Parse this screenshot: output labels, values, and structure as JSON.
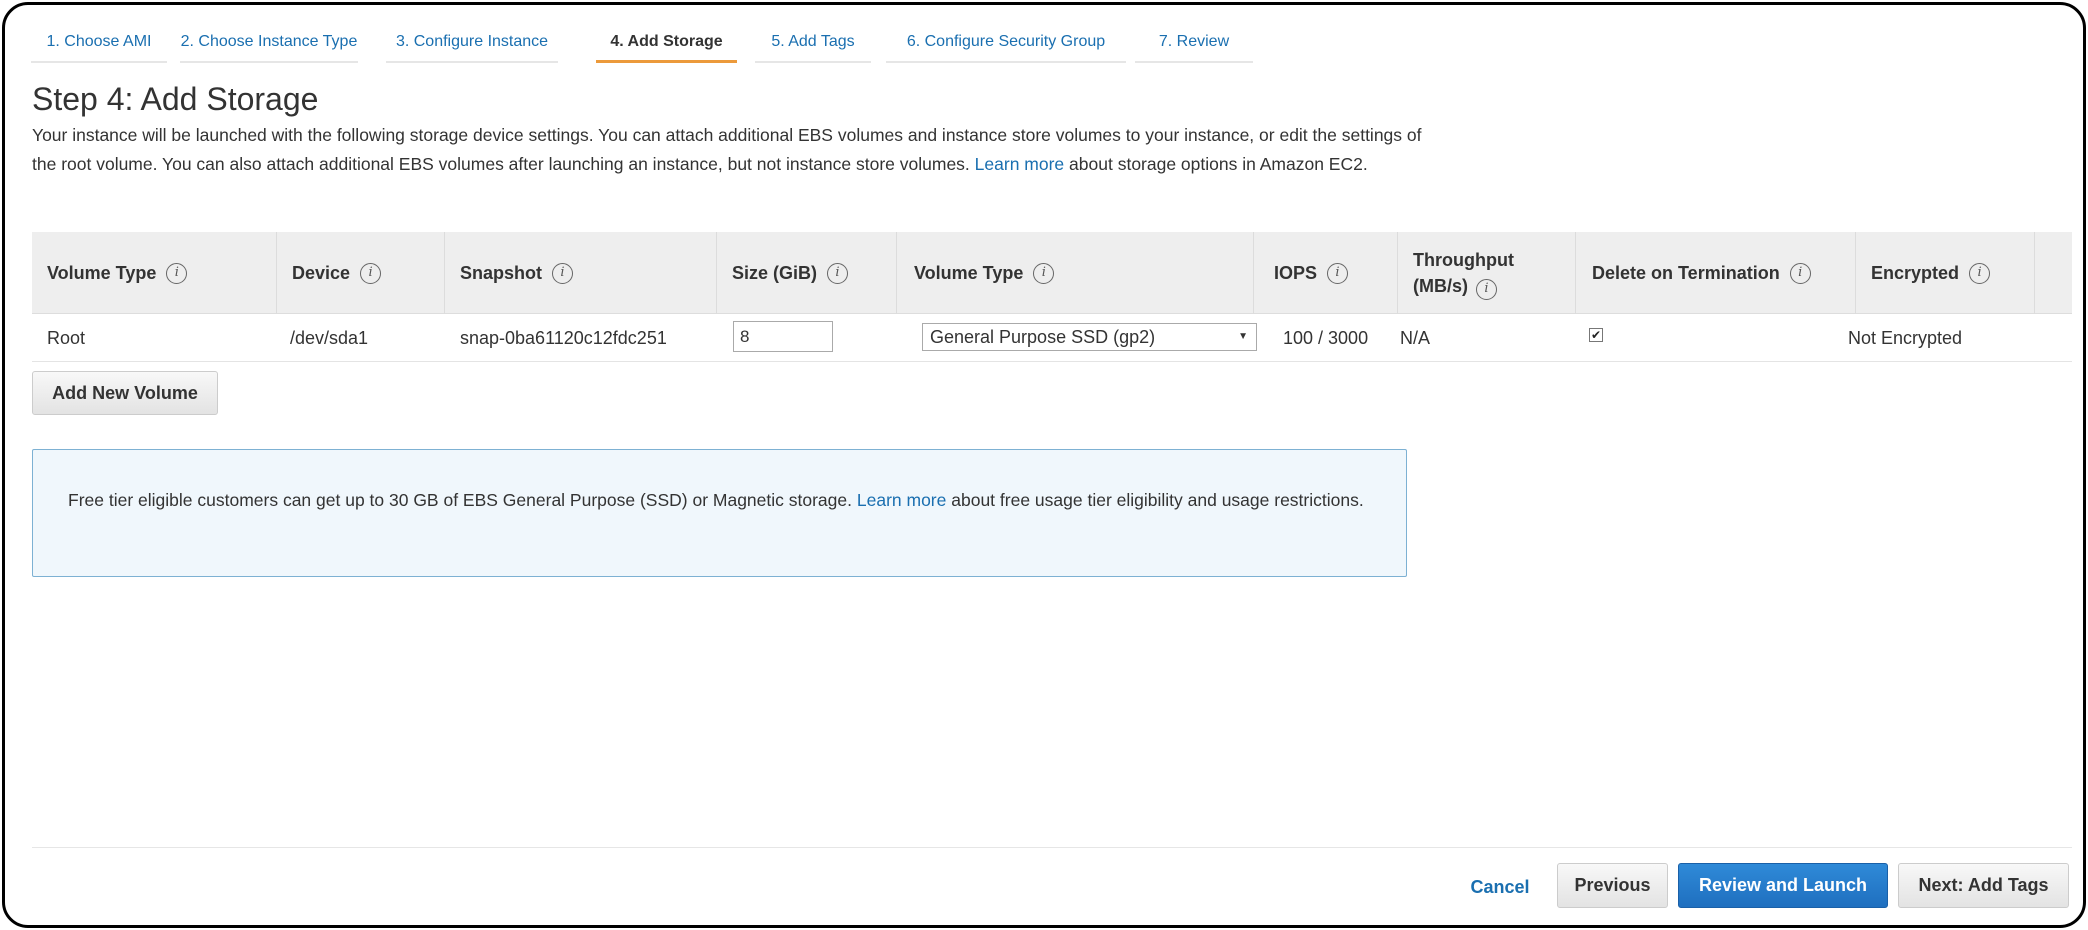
{
  "wizard_tabs": [
    {
      "label": "1. Choose AMI"
    },
    {
      "label": "2. Choose Instance Type"
    },
    {
      "label": "3. Configure Instance"
    },
    {
      "label": "4. Add Storage",
      "active": true
    },
    {
      "label": "5. Add Tags"
    },
    {
      "label": "6. Configure Security Group"
    },
    {
      "label": "7. Review"
    }
  ],
  "page": {
    "title": "Step 4: Add Storage",
    "desc_before": "Your instance will be launched with the following storage device settings. You can attach additional EBS volumes and instance store volumes to your instance, or edit the settings of the root volume. You can also attach additional EBS volumes after launching an instance, but not instance store volumes.",
    "desc_link": "Learn more",
    "desc_after": "about storage options in Amazon EC2."
  },
  "table": {
    "headers": {
      "volume_type": "Volume Type",
      "device": "Device",
      "snapshot": "Snapshot",
      "size": "Size (GiB)",
      "volume_type2": "Volume Type",
      "iops": "IOPS",
      "throughput_line1": "Throughput",
      "throughput_line2": "(MB/s)",
      "delete_on_termination": "Delete on Termination",
      "encrypted": "Encrypted"
    },
    "info_icon": "i",
    "row": {
      "volume_type": "Root",
      "device": "/dev/sda1",
      "snapshot": "snap-0ba61120c12fdc251",
      "size": "8",
      "volume_type_selected": "General Purpose SSD (gp2)",
      "iops": "100 / 3000",
      "throughput": "N/A",
      "delete_on_termination": true,
      "encrypted": "Not Encrypted"
    }
  },
  "add_volume_button": "Add New Volume",
  "info_box": {
    "text_before": "Free tier eligible customers can get up to 30 GB of EBS General Purpose (SSD) or Magnetic storage.",
    "link": "Learn more",
    "text_after": "about free usage tier eligibility and usage restrictions."
  },
  "footer": {
    "cancel": "Cancel",
    "previous": "Previous",
    "review_and_launch": "Review and Launch",
    "next": "Next: Add Tags"
  },
  "colors": {
    "link": "#1a6fb0",
    "active_tab_underline": "#ec9a3b",
    "primary_button": "#1f6fbf",
    "info_box_border": "#7db1d3",
    "info_box_bg": "#f0f7fc"
  }
}
